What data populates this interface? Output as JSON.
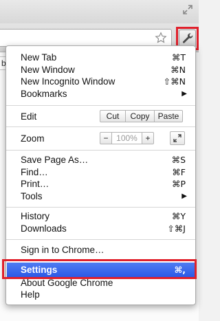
{
  "menu": {
    "group1": [
      {
        "label": "New Tab",
        "shortcut": "⌘T"
      },
      {
        "label": "New Window",
        "shortcut": "⌘N"
      },
      {
        "label": "New Incognito Window",
        "shortcut": "⇧⌘N"
      },
      {
        "label": "Bookmarks",
        "submenu": true
      }
    ],
    "edit": {
      "label": "Edit",
      "cut": "Cut",
      "copy": "Copy",
      "paste": "Paste"
    },
    "zoom": {
      "label": "Zoom",
      "minus": "−",
      "value": "100%",
      "plus": "+"
    },
    "group3": [
      {
        "label": "Save Page As…",
        "shortcut": "⌘S"
      },
      {
        "label": "Find…",
        "shortcut": "⌘F"
      },
      {
        "label": "Print…",
        "shortcut": "⌘P"
      },
      {
        "label": "Tools",
        "submenu": true
      }
    ],
    "group4": [
      {
        "label": "History",
        "shortcut": "⌘Y"
      },
      {
        "label": "Downloads",
        "shortcut": "⇧⌘J"
      }
    ],
    "sign_in": "Sign in to Chrome…",
    "settings": {
      "label": "Settings",
      "shortcut": "⌘,"
    },
    "about": "About Google Chrome",
    "help": "Help",
    "submenu_arrow": "▶"
  },
  "bookmark_peek": "b",
  "colors": {
    "highlight": "#e0202b",
    "selection": "#2a58e6"
  },
  "icons": {
    "toolbar_menu": "wrench-icon",
    "bookmark_star": "star-icon",
    "fullscreen": "fullscreen-icon"
  }
}
